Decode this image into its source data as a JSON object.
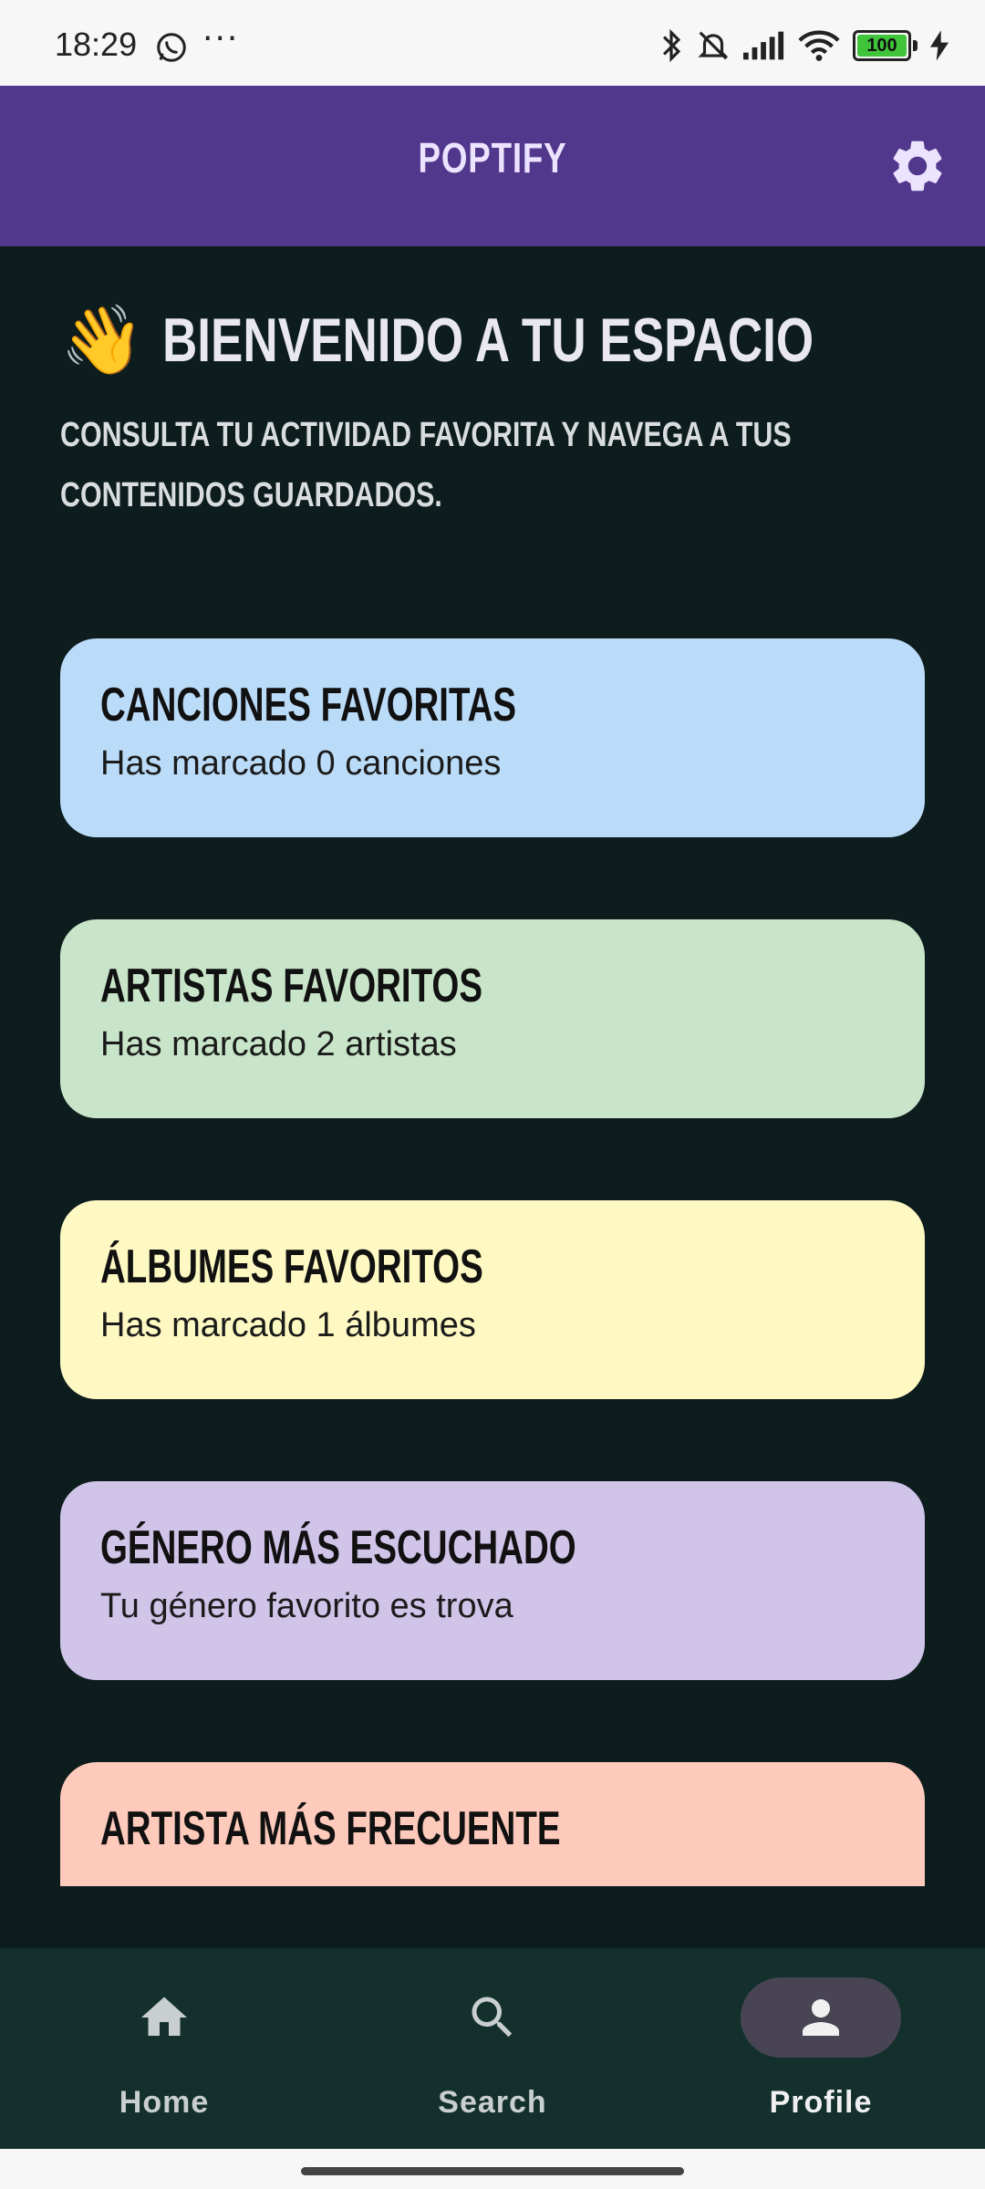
{
  "status_bar": {
    "time": "18:29",
    "overflow": "···",
    "battery": "100"
  },
  "app_bar": {
    "title": "POPTIFY",
    "settings_icon": "gear-icon"
  },
  "welcome": {
    "emoji": "👋",
    "title": "BIENVENIDO A TU ESPACIO",
    "subtitle": "CONSULTA TU ACTIVIDAD FAVORITA Y NAVEGA A TUS CONTENIDOS GUARDADOS."
  },
  "cards": [
    {
      "title": "CANCIONES FAVORITAS",
      "description": "Has marcado 0 canciones",
      "color": "#bbdcf9"
    },
    {
      "title": "ARTISTAS FAVORITOS",
      "description": "Has marcado 2 artistas",
      "color": "#c8e5c9"
    },
    {
      "title": "ÁLBUMES FAVORITOS",
      "description": "Has marcado 1 álbumes",
      "color": "#fef9c2"
    },
    {
      "title": "GÉNERO MÁS ESCUCHADO",
      "description": "Tu género favorito es trova",
      "color": "#d0c4e9"
    },
    {
      "title": "ARTISTA MÁS FRECUENTE",
      "description": "",
      "color": "#fecabb"
    }
  ],
  "bottom_nav": [
    {
      "label": "Home",
      "icon": "home-icon",
      "active": false
    },
    {
      "label": "Search",
      "icon": "search-icon",
      "active": false
    },
    {
      "label": "Profile",
      "icon": "person-icon",
      "active": true
    }
  ],
  "colors": {
    "app_bar": "#51388c",
    "background": "#0d1c1d",
    "nav_bar": "#14302d",
    "nav_active_pill": "#484453"
  }
}
